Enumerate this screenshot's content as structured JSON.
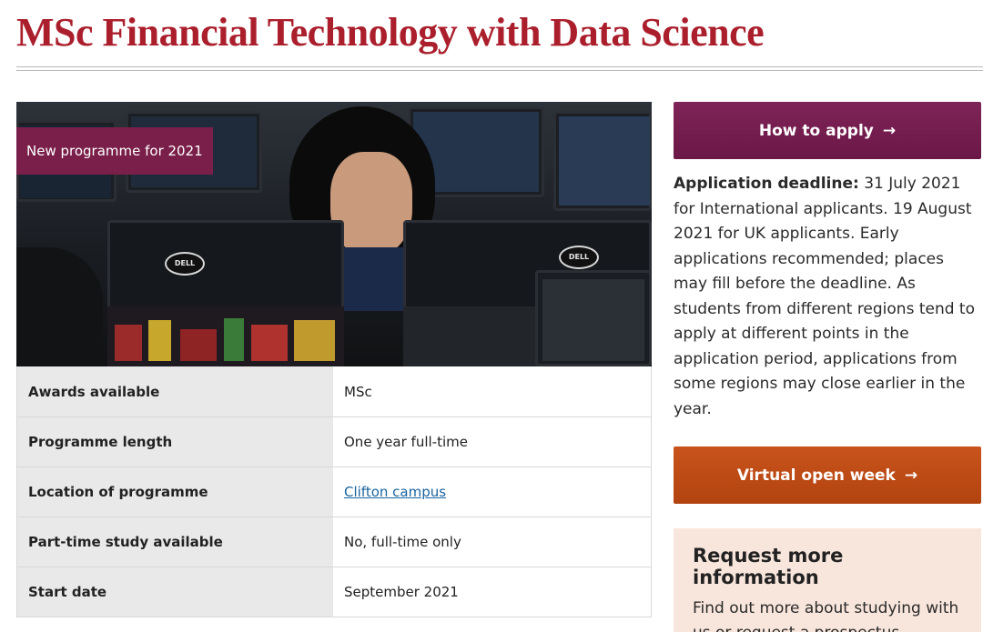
{
  "page": {
    "title": "MSc Financial Technology with Data Science"
  },
  "hero": {
    "badge": "New programme for 2021",
    "monitor_logo": "DELL"
  },
  "facts": [
    {
      "label": "Awards available",
      "value": "MSc"
    },
    {
      "label": "Programme length",
      "value": "One year full-time"
    },
    {
      "label": "Location of programme",
      "value": "Clifton campus"
    },
    {
      "label": "Part-time study available",
      "value": "No, full-time only"
    },
    {
      "label": "Start date",
      "value": "September 2021"
    }
  ],
  "sidebar": {
    "apply_button": "How to apply",
    "deadline_label": "Application deadline:",
    "deadline_text": "31 July 2021 for International applicants. 19 August 2021 for UK applicants. Early applications recommended; places may fill before the deadline. As students from different regions tend to apply at different points in the application period, applications from some regions may close earlier in the year.",
    "open_week_button": "Virtual open week",
    "arrow_glyph": "→",
    "info_title": "Request more information",
    "info_text": "Find out more about studying with us or request a prospectus."
  },
  "colors": {
    "title": "#ab1f2d",
    "apply_button": "#7a1f4a",
    "open_week_button": "#c24d18",
    "info_box_bg": "#f8e6dc",
    "link": "#1a64a0"
  }
}
